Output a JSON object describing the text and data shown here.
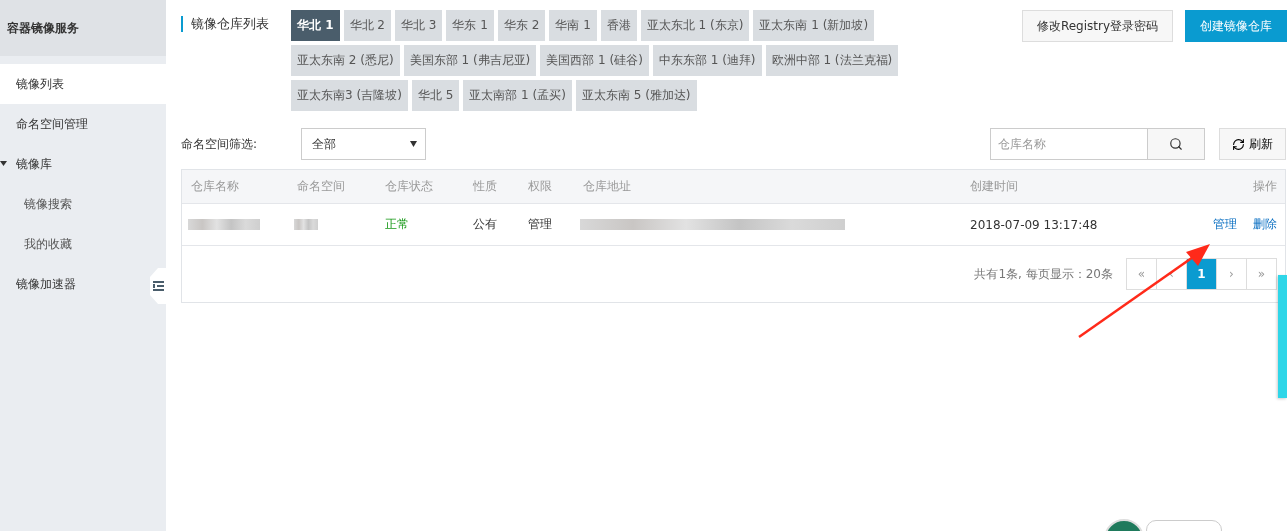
{
  "sidebar": {
    "title": "容器镜像服务",
    "items": [
      {
        "label": "镜像列表",
        "selected": true
      },
      {
        "label": "命名空间管理",
        "selected": false
      },
      {
        "label": "镜像库",
        "selected": false,
        "expanded": true,
        "children": [
          {
            "label": "镜像搜索",
            "selected": false
          },
          {
            "label": "我的收藏",
            "selected": false
          }
        ]
      },
      {
        "label": "镜像加速器",
        "selected": false
      }
    ]
  },
  "header": {
    "title": "镜像仓库列表",
    "buttons": [
      {
        "label": "修改Registry登录密码",
        "kind": "secondary"
      },
      {
        "label": "创建镜像仓库",
        "kind": "primary"
      }
    ]
  },
  "region_tabs": {
    "rows": [
      {
        "tabs": [
          {
            "label": "华北 1",
            "selected": true
          },
          {
            "label": "华北 2",
            "selected": false
          },
          {
            "label": "华北 3",
            "selected": false
          },
          {
            "label": "华东 1",
            "selected": false
          },
          {
            "label": "华东 2",
            "selected": false
          },
          {
            "label": "华南 1",
            "selected": false
          },
          {
            "label": "香港",
            "selected": false
          },
          {
            "label": "亚太东北 1 (东京)",
            "selected": false
          },
          {
            "label": "亚太东南 1 (新加坡)",
            "selected": false
          }
        ]
      },
      {
        "tabs": [
          {
            "label": "亚太东南 2 (悉尼)",
            "selected": false
          },
          {
            "label": "美国东部 1 (弗吉尼亚)",
            "selected": false
          },
          {
            "label": "美国西部 1 (硅谷)",
            "selected": false
          },
          {
            "label": "中东东部 1 (迪拜)",
            "selected": false
          },
          {
            "label": "欧洲中部 1 (法兰克福)",
            "selected": false
          }
        ]
      },
      {
        "tabs": [
          {
            "label": "亚太东南3 (吉隆坡)",
            "selected": false
          },
          {
            "label": "华北 5",
            "selected": false
          },
          {
            "label": "亚太南部 1 (孟买)",
            "selected": false
          },
          {
            "label": "亚太东南 5 (雅加达)",
            "selected": false
          }
        ]
      }
    ]
  },
  "filter": {
    "label": "命名空间筛选:",
    "value": "全部"
  },
  "search": {
    "placeholder": "仓库名称"
  },
  "refresh_button": {
    "label": "刷新"
  },
  "table": {
    "columns": [
      "仓库名称",
      "命名空间",
      "仓库状态",
      "性质",
      "权限",
      "仓库地址",
      "创建时间",
      "操作"
    ],
    "rows": [
      {
        "name": {
          "kind": "redacted"
        },
        "namespace": {
          "kind": "redacted"
        },
        "status": "正常",
        "type": "公有",
        "permission": "管理",
        "address": {
          "kind": "redacted"
        },
        "created": "2018-07-09 13:17:48",
        "actions": [
          "管理",
          "删除"
        ]
      }
    ]
  },
  "pagination": {
    "summary": "共有1条, 每页显示：20条",
    "pages": [
      {
        "label": "«",
        "selected": false
      },
      {
        "label": "‹",
        "selected": false
      },
      {
        "label": "1",
        "selected": true
      },
      {
        "label": "›",
        "selected": false
      },
      {
        "label": "»",
        "selected": false
      }
    ]
  }
}
